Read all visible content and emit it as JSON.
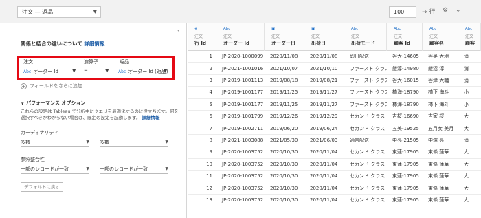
{
  "topbar": {
    "source_select": "注文 — 返品",
    "rows_select": "100",
    "arrow_rows_icon": "→ 行",
    "gear_icon": "⚙",
    "chevron_icon": "⌄"
  },
  "left_panel": {
    "collapse_icon": "‹",
    "help_text": "関係と結合の違いについて",
    "help_link": "詳細情報",
    "join": {
      "col1_header": "注文",
      "col2_header": "演算子",
      "col3_header": "返品",
      "left_field": "オーダー Id",
      "operator": "=",
      "right_field": "オーダー Id (返品)",
      "abc_label": "Abc"
    },
    "add_field": "フィールドをさらに追加",
    "perf": {
      "title": "パフォーマンス オプション",
      "desc": "これらの設定は Tableau で分析中にクエリを最適化するのに役立ちます。何を選択すべきかわからない場合は、既定の設定を起動します。",
      "desc_link": "詳細情報",
      "cardinality_label": "カーディナリティ",
      "cardinality_left": "多数",
      "cardinality_right": "多数",
      "integrity_label": "参照整合性",
      "integrity_left": "一部のレコードが一致",
      "integrity_right": "一部のレコードが一致",
      "reset_button": "デフォルトに戻す"
    }
  },
  "grid": {
    "columns": [
      {
        "type": "#",
        "source": "注文",
        "name": "行 Id"
      },
      {
        "type": "Abc",
        "source": "注文",
        "name": "オーダー Id"
      },
      {
        "type": "▣",
        "source": "注文",
        "name": "オーダー日"
      },
      {
        "type": "▣",
        "source": "注文",
        "name": "出荷日"
      },
      {
        "type": "Abc",
        "source": "注文",
        "name": "出荷モード"
      },
      {
        "type": "Abc",
        "source": "注文",
        "name": "顧客 Id"
      },
      {
        "type": "Abc",
        "source": "注文",
        "name": "顧客名"
      },
      {
        "type": "Abc",
        "source": "注文",
        "name": "顧客"
      }
    ],
    "rows": [
      [
        "1",
        "JP-2020-1000099",
        "2020/11/08",
        "2020/11/08",
        "即日配送",
        "谷大-14605",
        "谷奥 大地",
        "消"
      ],
      [
        "2",
        "JP-2021-1001016",
        "2021/10/07",
        "2021/10/10",
        "ファースト クラス",
        "飯淳-14980",
        "飯沼 淳",
        "消"
      ],
      [
        "3",
        "JP-2019-1001113",
        "2019/08/18",
        "2019/08/21",
        "ファースト クラス",
        "谷大-16015",
        "谷津 大輔",
        "消"
      ],
      [
        "4",
        "JP-2019-1001177",
        "2019/11/25",
        "2019/11/27",
        "ファースト クラス",
        "柿海-18790",
        "柿下 海斗",
        "小"
      ],
      [
        "5",
        "JP-2019-1001177",
        "2019/11/25",
        "2019/11/27",
        "ファースト クラス",
        "柿海-18790",
        "柿下 海斗",
        "小"
      ],
      [
        "6",
        "JP-2019-1001799",
        "2019/12/26",
        "2019/12/29",
        "セカンド クラス",
        "吉桜-16690",
        "吉家 桜",
        "大"
      ],
      [
        "7",
        "JP-2019-1002711",
        "2019/06/20",
        "2019/06/24",
        "セカンド クラス",
        "五美-19525",
        "五月女 美月",
        "大"
      ],
      [
        "8",
        "JP-2021-1003088",
        "2021/05/30",
        "2021/06/03",
        "通常配送",
        "中亮-21505",
        "中澤 亮",
        "消"
      ],
      [
        "9",
        "JP-2020-1003752",
        "2020/10/30",
        "2020/11/04",
        "セカンド クラス",
        "東蓮-17905",
        "東條 蓮華",
        "大"
      ],
      [
        "10",
        "JP-2020-1003752",
        "2020/10/30",
        "2020/11/04",
        "セカンド クラス",
        "東蓮-17905",
        "東條 蓮華",
        "大"
      ],
      [
        "11",
        "JP-2020-1003752",
        "2020/10/30",
        "2020/11/04",
        "セカンド クラス",
        "東蓮-17905",
        "東條 蓮華",
        "大"
      ],
      [
        "12",
        "JP-2020-1003752",
        "2020/10/30",
        "2020/11/04",
        "セカンド クラス",
        "東蓮-17905",
        "東條 蓮華",
        "大"
      ],
      [
        "13",
        "JP-2020-1003752",
        "2020/10/30",
        "2020/11/04",
        "セカンド クラス",
        "東蓮-17905",
        "東條 蓮華",
        "大"
      ]
    ]
  },
  "colors": {
    "highlight": "#e50914",
    "link": "#1f5fa8",
    "type_icon": "#1f6fc8"
  }
}
